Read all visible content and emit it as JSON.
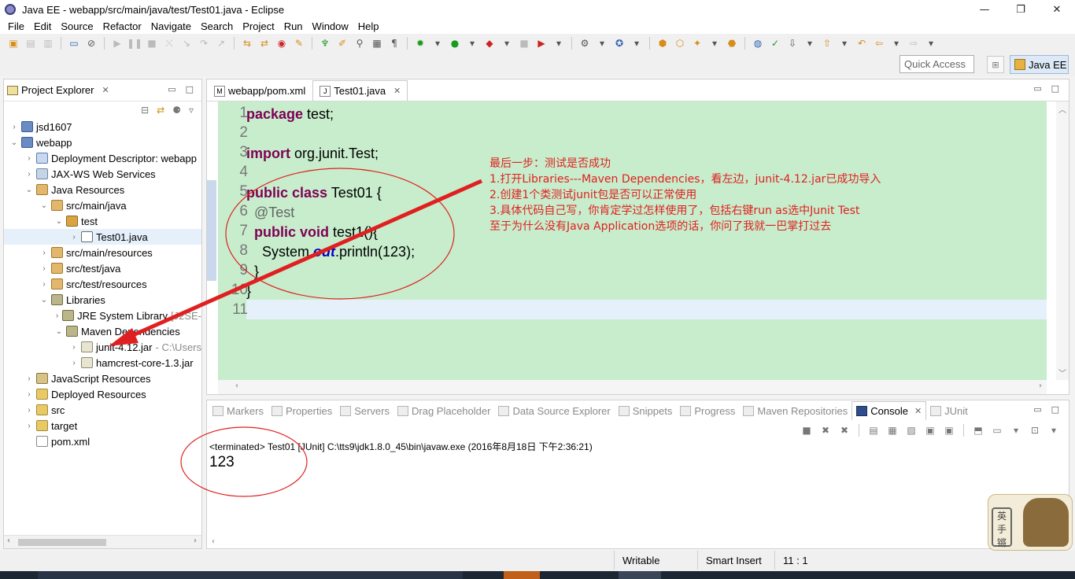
{
  "window": {
    "title": "Java EE - webapp/src/main/java/test/Test01.java - Eclipse",
    "minimize": "—",
    "maximize": "❐",
    "close": "✕"
  },
  "menu": [
    "File",
    "Edit",
    "Source",
    "Refactor",
    "Navigate",
    "Search",
    "Project",
    "Run",
    "Window",
    "Help"
  ],
  "quick_access": {
    "placeholder": "Quick Access"
  },
  "perspective": {
    "label": "Java EE"
  },
  "project_explorer": {
    "title": "Project Explorer",
    "close": "✕",
    "tree": [
      {
        "twisty": "›",
        "icon": "proj",
        "label": "jsd1607",
        "indent": 0
      },
      {
        "twisty": "⌄",
        "icon": "proj",
        "label": "webapp",
        "indent": 0
      },
      {
        "twisty": "›",
        "icon": "dd",
        "label": "Deployment Descriptor: webapp",
        "indent": 1
      },
      {
        "twisty": "›",
        "icon": "ws",
        "label": "JAX-WS Web Services",
        "indent": 1
      },
      {
        "twisty": "⌄",
        "icon": "pkgroot",
        "label": "Java Resources",
        "indent": 1
      },
      {
        "twisty": "⌄",
        "icon": "pkgroot",
        "label": "src/main/java",
        "indent": 2
      },
      {
        "twisty": "⌄",
        "icon": "pkg",
        "label": "test",
        "indent": 3
      },
      {
        "twisty": "›",
        "icon": "java",
        "label": "Test01.java",
        "indent": 4,
        "selected": true
      },
      {
        "twisty": "›",
        "icon": "pkgroot",
        "label": "src/main/resources",
        "indent": 2
      },
      {
        "twisty": "›",
        "icon": "pkgroot",
        "label": "src/test/java",
        "indent": 2
      },
      {
        "twisty": "›",
        "icon": "pkgroot",
        "label": "src/test/resources",
        "indent": 2
      },
      {
        "twisty": "⌄",
        "icon": "lib",
        "label": "Libraries",
        "indent": 2
      },
      {
        "twisty": "›",
        "icon": "lib",
        "label": "JRE System Library",
        "muted": "[J2SE-",
        "indent": 3
      },
      {
        "twisty": "⌄",
        "icon": "lib",
        "label": "Maven Dependencies",
        "indent": 3
      },
      {
        "twisty": "›",
        "icon": "jar",
        "label": "junit-4.12.jar",
        "muted": "- C:\\Users",
        "indent": 4
      },
      {
        "twisty": "›",
        "icon": "jar",
        "label": "hamcrest-core-1.3.jar",
        "indent": 4
      },
      {
        "twisty": "›",
        "icon": "js",
        "label": "JavaScript Resources",
        "indent": 1
      },
      {
        "twisty": "›",
        "icon": "folder",
        "label": "Deployed Resources",
        "indent": 1
      },
      {
        "twisty": "›",
        "icon": "folder",
        "label": "src",
        "indent": 1
      },
      {
        "twisty": "›",
        "icon": "folder",
        "label": "target",
        "indent": 1
      },
      {
        "twisty": "",
        "icon": "xml",
        "label": "pom.xml",
        "indent": 1
      }
    ]
  },
  "editor": {
    "tabs": [
      {
        "label": "webapp/pom.xml",
        "icon": "M",
        "active": false
      },
      {
        "label": "Test01.java",
        "icon": "J",
        "active": true
      }
    ],
    "close": "✕",
    "lines": [
      {
        "n": "1",
        "tokens": [
          {
            "t": "package",
            "c": "kw"
          },
          {
            "t": " test;"
          }
        ]
      },
      {
        "n": "2",
        "tokens": []
      },
      {
        "n": "3",
        "tokens": [
          {
            "t": "import",
            "c": "kw"
          },
          {
            "t": " org.junit.Test;"
          }
        ]
      },
      {
        "n": "4",
        "tokens": []
      },
      {
        "n": "5",
        "tokens": [
          {
            "t": "public",
            "c": "kw"
          },
          {
            "t": " "
          },
          {
            "t": "class",
            "c": "kw"
          },
          {
            "t": " Test01 {"
          }
        ]
      },
      {
        "n": "6",
        "tokens": [
          {
            "t": "  "
          },
          {
            "t": "@Test",
            "c": "ann"
          }
        ]
      },
      {
        "n": "7",
        "tokens": [
          {
            "t": "  "
          },
          {
            "t": "public",
            "c": "kw"
          },
          {
            "t": " "
          },
          {
            "t": "void",
            "c": "kw"
          },
          {
            "t": " test1(){"
          }
        ]
      },
      {
        "n": "8",
        "tokens": [
          {
            "t": "    System."
          },
          {
            "t": "out",
            "c": "fld"
          },
          {
            "t": ".println(123);"
          }
        ]
      },
      {
        "n": "9",
        "tokens": [
          {
            "t": "  }"
          }
        ]
      },
      {
        "n": "10",
        "tokens": [
          {
            "t": "}"
          }
        ]
      },
      {
        "n": "11",
        "tokens": []
      }
    ]
  },
  "annotation": {
    "lines": [
      "最后一步：测试是否成功",
      "1.打开Libraries---Maven Dependencies，看左边，junit-4.12.jar已成功导入",
      "2.创建1个类测试junit包是否可以正常使用",
      "3.具体代码自己写，你肯定学过怎样使用了，包括右键run as选中Junit Test",
      "至于为什么没有Java Application选项的话，你问了我就一巴掌打过去"
    ],
    "color": "#e02020"
  },
  "console": {
    "tabs": [
      {
        "label": "Markers",
        "active": false
      },
      {
        "label": "Properties",
        "active": false
      },
      {
        "label": "Servers",
        "active": false
      },
      {
        "label": "Drag Placeholder",
        "active": false
      },
      {
        "label": "Data Source Explorer",
        "active": false
      },
      {
        "label": "Snippets",
        "active": false
      },
      {
        "label": "Progress",
        "active": false
      },
      {
        "label": "Maven Repositories",
        "active": false
      },
      {
        "label": "Console",
        "active": true
      },
      {
        "label": "JUnit",
        "active": false
      }
    ],
    "terminated": "<terminated> Test01 [JUnit] C:\\tts9\\jdk1.8.0_45\\bin\\javaw.exe (2016年8月18日 下午2:36:21)",
    "output": "123"
  },
  "status": {
    "writable": "Writable",
    "insert_mode": "Smart Insert",
    "position": "11 : 1"
  },
  "stamp": {
    "text": [
      "英",
      "手",
      "锵"
    ]
  },
  "colors": {
    "editor_bg": "#c7edcc",
    "keyword": "#7f0055",
    "annotation_red": "#e02020"
  }
}
